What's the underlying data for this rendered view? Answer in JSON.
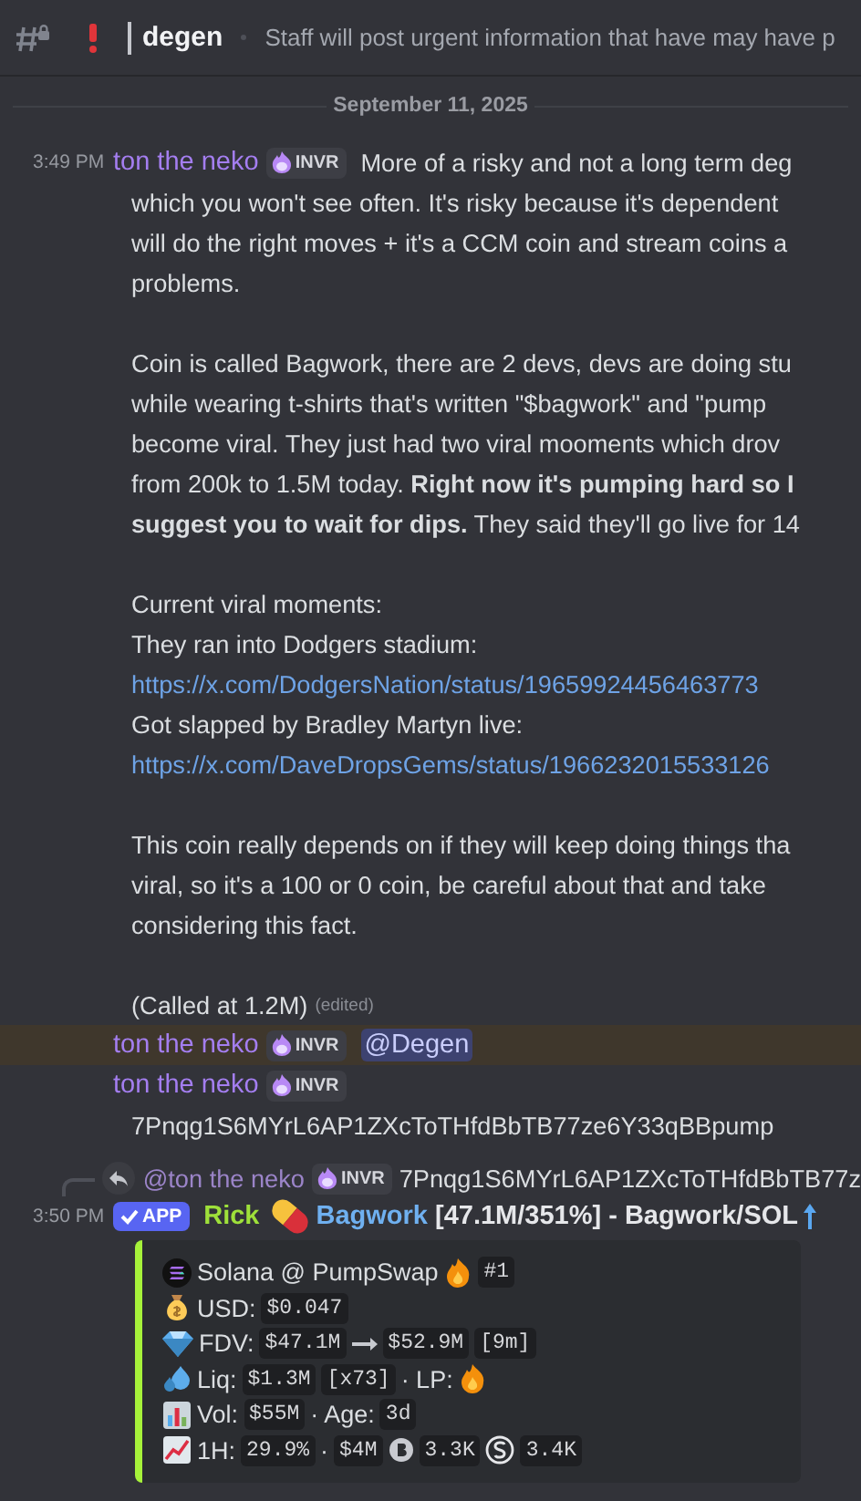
{
  "header": {
    "channel": "degen",
    "topic": "Staff will post urgent information that have may have p"
  },
  "date_divider": "September 11, 2025",
  "messages": [
    {
      "kind": "user",
      "time": "3:49 PM",
      "author": "ton the neko",
      "color": "#a47ef0",
      "role_tag": "INVR",
      "highlighted": false,
      "inline": [
        {
          "kind": "text",
          "text": "More of a risky and not a long term deg"
        }
      ],
      "lines": [
        {
          "kind": "text",
          "text": "which you won't see often. It's risky because it's dependent"
        },
        {
          "kind": "text",
          "text": "will do the right moves + it's a CCM coin and stream coins a"
        },
        {
          "kind": "text",
          "text": "problems."
        },
        {
          "kind": "gap"
        },
        {
          "kind": "text",
          "text": "Coin is called Bagwork, there are 2 devs, devs are doing stu"
        },
        {
          "kind": "text",
          "text": "while wearing t-shirts that's written \"$bagwork\" and \"pump"
        },
        {
          "kind": "text",
          "text": "become viral. They just had two viral mooments which drov"
        },
        {
          "kind": "text",
          "text": "from 200k to 1.5M today. **Right now it's pumping hard so I**"
        },
        {
          "kind": "text",
          "text": "**suggest you to wait for dips.** They said they'll go live for 14"
        },
        {
          "kind": "gap"
        },
        {
          "kind": "text",
          "text": "Current viral moments:"
        },
        {
          "kind": "text",
          "text": "They ran into Dodgers stadium:"
        },
        {
          "kind": "link",
          "text": "https://x.com/DodgersNation/status/19659924456463773"
        },
        {
          "kind": "text",
          "text": "Got slapped by Bradley Martyn live:"
        },
        {
          "kind": "link",
          "text": "https://x.com/DaveDropsGems/status/1966232015533126"
        },
        {
          "kind": "gap"
        },
        {
          "kind": "text",
          "text": "This coin really depends on if they will keep doing things tha"
        },
        {
          "kind": "text",
          "text": "viral, so it's a 100 or 0 coin, be careful about that and take"
        },
        {
          "kind": "text",
          "text": "considering this fact."
        },
        {
          "kind": "gap"
        },
        {
          "kind": "text",
          "text": "(Called at 1.2M)",
          "edited": "(edited)"
        }
      ]
    },
    {
      "kind": "user",
      "author": "ton the neko",
      "color": "#a47ef0",
      "role_tag": "INVR",
      "highlighted": true,
      "inline": [
        {
          "kind": "mention",
          "text": "@Degen"
        }
      ]
    },
    {
      "kind": "user",
      "author": "ton the neko",
      "color": "#a47ef0",
      "role_tag": "INVR",
      "highlighted": false,
      "lines": [
        {
          "kind": "text",
          "text": "7Pnqg1S6MYrL6AP1ZXcToTHfdBbTB77ze6Y33qBBpump"
        }
      ]
    },
    {
      "kind": "bot",
      "reply": {
        "author": "@ton the neko",
        "role_tag": "INVR",
        "text": "7Pnqg1S6MYrL6AP1ZXcToTHfdBbTB77z"
      },
      "time": "3:50 PM",
      "app_tag": "APP",
      "author": "Rick",
      "color": "#9ee03a",
      "title": [
        {
          "kind": "pill"
        },
        {
          "kind": "link",
          "text": "Bagwork"
        },
        {
          "kind": "bold",
          "text": "[47.1M/351%] - Bagwork/SOL"
        },
        {
          "kind": "up_arrow"
        }
      ],
      "embed": {
        "color": "#a6f23a",
        "lines": [
          [
            {
              "kind": "solana"
            },
            {
              "kind": "text",
              "text": "Solana @ PumpSwap"
            },
            {
              "kind": "fire"
            },
            {
              "kind": "code",
              "text": "#1"
            }
          ],
          [
            {
              "kind": "money_bag"
            },
            {
              "kind": "text",
              "text": "USD:"
            },
            {
              "kind": "code",
              "text": "$0.047"
            }
          ],
          [
            {
              "kind": "gem"
            },
            {
              "kind": "text",
              "text": "FDV:"
            },
            {
              "kind": "code",
              "text": "$47.1M"
            },
            {
              "kind": "right_arrow"
            },
            {
              "kind": "code",
              "text": "$52.9M"
            },
            {
              "kind": "code",
              "text": "[9m]"
            }
          ],
          [
            {
              "kind": "droplets"
            },
            {
              "kind": "text",
              "text": "Liq:"
            },
            {
              "kind": "code",
              "text": "$1.3M"
            },
            {
              "kind": "code",
              "text": "[x73]"
            },
            {
              "kind": "text",
              "text": "· LP:"
            },
            {
              "kind": "fire"
            }
          ],
          [
            {
              "kind": "bar_chart"
            },
            {
              "kind": "text",
              "text": "Vol:"
            },
            {
              "kind": "code",
              "text": "$55M"
            },
            {
              "kind": "text",
              "text": "· Age:"
            },
            {
              "kind": "code",
              "text": "3d"
            }
          ],
          [
            {
              "kind": "chart_up"
            },
            {
              "kind": "text",
              "text": "1H:"
            },
            {
              "kind": "code",
              "text": "29.9%"
            },
            {
              "kind": "text",
              "text": "·"
            },
            {
              "kind": "code",
              "text": "$4M"
            },
            {
              "kind": "b_coin"
            },
            {
              "kind": "code",
              "text": "3.3K"
            },
            {
              "kind": "s_coin"
            },
            {
              "kind": "code",
              "text": "3.4K"
            }
          ]
        ]
      }
    }
  ]
}
